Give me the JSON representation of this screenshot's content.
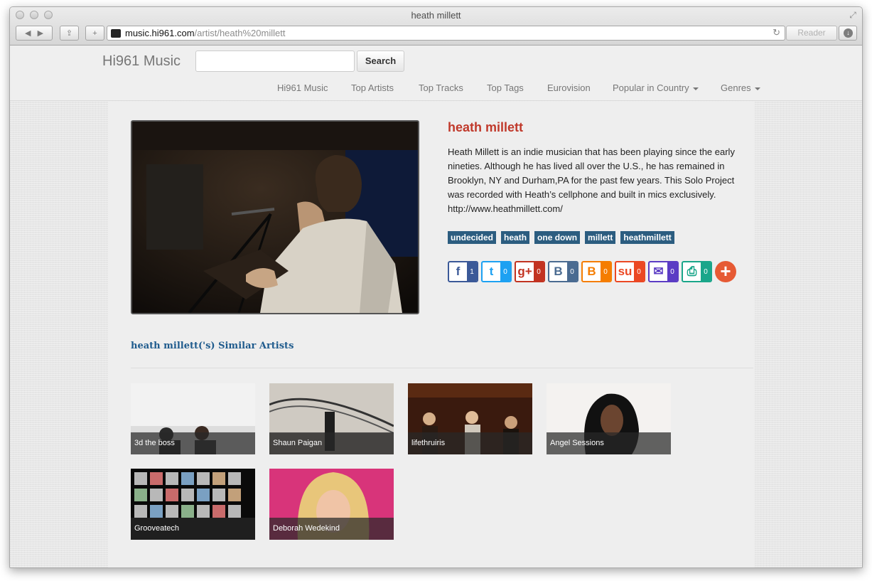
{
  "browser": {
    "window_title": "heath millett",
    "url_host": "music.hi961.com",
    "url_path": "/artist/heath%20millett",
    "reader_label": "Reader"
  },
  "site": {
    "brand": "Hi961 Music",
    "search_button": "Search",
    "search_value": "",
    "nav": [
      "Hi961 Music",
      "Top Artists",
      "Top Tracks",
      "Top Tags",
      "Eurovision",
      "Popular in Country",
      "Genres"
    ]
  },
  "artist": {
    "name": "heath millett",
    "bio": "Heath Millett is an indie musician that has been playing since the early nineties. Although he has lived all over the U.S., he has remained in Brooklyn, NY and Durham,PA for the past few years. This Solo Project was recorded with Heath’s cellphone and built in mics exclusively. http://www.heathmillett.com/",
    "tags": [
      "undecided",
      "heath",
      "one down",
      "millett",
      "heathmillett"
    ]
  },
  "shares": [
    {
      "icon": "facebook-icon",
      "glyph": "f",
      "count": "1",
      "color": "#3b5998"
    },
    {
      "icon": "twitter-icon",
      "glyph": "t",
      "count": "0",
      "color": "#1da1f2"
    },
    {
      "icon": "google-plus-icon",
      "glyph": "g+",
      "count": "0",
      "color": "#c23321"
    },
    {
      "icon": "vk-icon",
      "glyph": "B",
      "count": "0",
      "color": "#4a6b91"
    },
    {
      "icon": "blogger-icon",
      "glyph": "B",
      "count": "0",
      "color": "#f57d00"
    },
    {
      "icon": "stumbleupon-icon",
      "glyph": "su",
      "count": "0",
      "color": "#eb4823"
    },
    {
      "icon": "email-icon",
      "glyph": "✉",
      "count": "0",
      "color": "#5b3cc4"
    },
    {
      "icon": "print-icon",
      "glyph": "⎙",
      "count": "0",
      "color": "#1aa68a"
    }
  ],
  "similar": {
    "title": "heath millett('s) Similar Artists",
    "artists": [
      "3d the boss",
      "Shaun Paigan",
      "lifethruiris",
      "Angel Sessions",
      "Grooveatech",
      "Deborah Wedekind"
    ]
  }
}
